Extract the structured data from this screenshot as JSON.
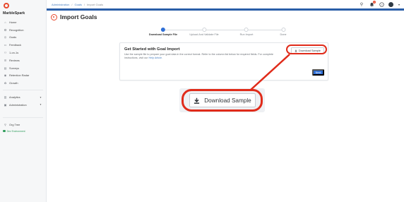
{
  "app": {
    "brand": "MarbleSpark"
  },
  "sidebar": {
    "items": [
      {
        "label": "Home",
        "icon": "home-icon",
        "glyph": "⌂"
      },
      {
        "label": "Recognition",
        "icon": "award-icon",
        "glyph": "✪"
      },
      {
        "label": "Goals",
        "icon": "target-icon",
        "glyph": "◎"
      },
      {
        "label": "Feedback",
        "icon": "chat-icon",
        "glyph": "▭"
      },
      {
        "label": "1-on-1s",
        "icon": "people-icon",
        "glyph": "⚇"
      },
      {
        "label": "Reviews",
        "icon": "review-icon",
        "glyph": "☰"
      },
      {
        "label": "Surveys",
        "icon": "survey-icon",
        "glyph": "▤"
      },
      {
        "label": "Retention Radar",
        "icon": "radar-icon",
        "glyph": "◉"
      },
      {
        "label": "Growth",
        "icon": "growth-icon",
        "glyph": "✿"
      }
    ],
    "sections": [
      {
        "label": "Analytics",
        "icon": "chart-icon",
        "glyph": "▥",
        "caret": "▼"
      },
      {
        "label": "Administration",
        "icon": "admin-icon",
        "glyph": "▣",
        "caret": "▼"
      }
    ],
    "org_tree": {
      "label": "Org Tree",
      "icon": "org-tree-icon",
      "glyph": "⚲"
    },
    "environment": {
      "label": "Dev Environment",
      "color": "#2e9c5b"
    }
  },
  "header": {
    "breadcrumb": [
      "Administration",
      "Goals",
      "Import Goals"
    ],
    "separator": "/",
    "notification_count": "1",
    "icons": {
      "search": {
        "name": "search-icon",
        "glyph": "⚲"
      },
      "bell": {
        "name": "bell-icon",
        "glyph": "🔔"
      },
      "help": {
        "name": "help-icon",
        "glyph": "?"
      },
      "menu": {
        "name": "chevron-down-icon",
        "glyph": "▾"
      }
    }
  },
  "page": {
    "title": "Import Goals",
    "title_icon": "goal-icon"
  },
  "stepper": {
    "steps": [
      {
        "label": "Download Sample File",
        "active": true
      },
      {
        "label": "Upload And Validate File",
        "active": false
      },
      {
        "label": "Run Import",
        "active": false
      },
      {
        "label": "Done",
        "active": false
      }
    ]
  },
  "card": {
    "title": "Get Started with Goal Import",
    "description": "Use the sample file to prepare your goal data in the correct format. Refer to the column list below for required fields. For complete instructions, visit our",
    "help_link": "Help Article.",
    "download_button": "Download Sample",
    "next_button": "Next"
  },
  "callout": {
    "label": "Download Sample",
    "highlight_color": "#e02b1a"
  },
  "colors": {
    "accent": "#2f6fd6",
    "brand": "#e8482c",
    "header_rule": "#2a5ea8"
  }
}
